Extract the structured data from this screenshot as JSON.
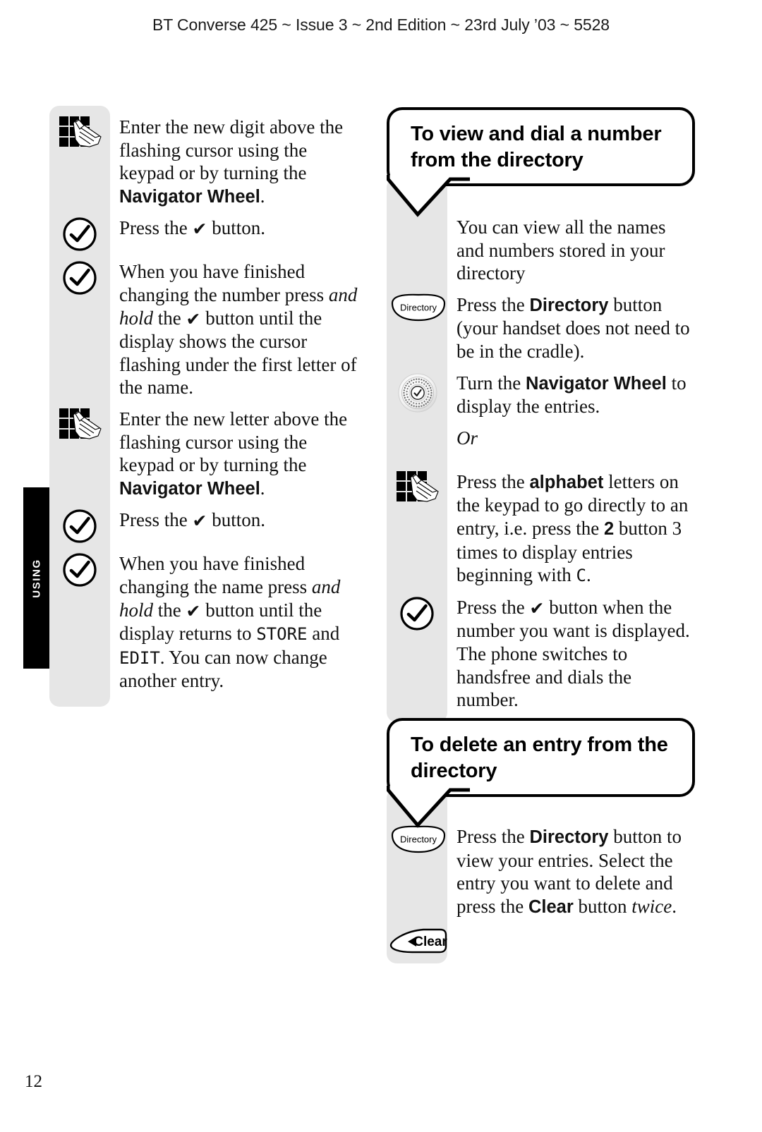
{
  "header": {
    "text": "BT Converse 425 ~ Issue 3 ~ 2nd Edition ~ 23rd July ’03 ~ 5528"
  },
  "side_tab": {
    "label": "USING"
  },
  "page_number": "12",
  "icon_labels": {
    "directory": "Directory",
    "clear": "Clear"
  },
  "left_column": {
    "steps": [
      {
        "icon": "keypad-icon",
        "text_html": "Enter the new digit above the flashing cursor using the keypad or by turning the <span class=\"b\">Navigator Wheel</span>."
      },
      {
        "icon": "check-button-icon",
        "text_html": "Press the <span class=\"tick-inline\">✔</span> button."
      },
      {
        "icon": "check-button-icon",
        "text_html": "When you have finished changing the number press <span class=\"i\">and hold</span> the <span class=\"tick-inline\">✔</span> button until the display shows the cursor flashing under the first letter of the name."
      },
      {
        "icon": "keypad-icon",
        "text_html": "Enter the new letter above the flashing cursor using the keypad or by turning the <span class=\"b\">Navigator Wheel</span>."
      },
      {
        "icon": "check-button-icon",
        "text_html": "Press the <span class=\"tick-inline\">✔</span> button."
      },
      {
        "icon": "check-button-icon",
        "text_html": "When you have finished changing the name press <span class=\"i\">and hold</span> the <span class=\"tick-inline\">✔</span> button until the display returns to <span class=\"lcd\">STORE</span> and <span class=\"lcd\">EDIT</span>. You can now change another entry."
      }
    ]
  },
  "section_view_dial": {
    "title": "To view and dial a number from the directory",
    "steps": [
      {
        "icon": "none",
        "text_html": "You can view all the names and numbers stored in your directory"
      },
      {
        "icon": "directory-button-icon",
        "text_html": "Press the <span class=\"b\">Directory</span> button (your handset does not need to be in the cradle)."
      },
      {
        "icon": "navigator-wheel-icon",
        "text_html": "Turn the <span class=\"b\">Navigator Wheel</span> to display the entries."
      },
      {
        "icon": "none",
        "text_html": "<span class=\"i\">Or</span>"
      },
      {
        "icon": "keypad-icon",
        "text_html": "Press the <span class=\"b\">alphabet</span> letters on the keypad to go directly to an entry, i.e. press the <span class=\"b\">2</span> button 3 times to display entries beginning with <span class=\"lcd\">C</span>."
      },
      {
        "icon": "check-button-icon",
        "text_html": "Press the <span class=\"tick-inline\">✔</span> button when the number you want is displayed. The phone  switches to handsfree and dials the number."
      }
    ]
  },
  "section_delete": {
    "title": "To delete an entry from the directory",
    "steps": [
      {
        "icon": "directory-button-icon",
        "text_html": "Press the <span class=\"b\">Directory</span> button to view your entries. Select the entry you want to delete and press the <span class=\"b\">Clear</span> button <span class=\"i\">twice</span>."
      },
      {
        "icon": "clear-button-icon",
        "text_html": ""
      }
    ]
  },
  "colors": {
    "panel_grey": "#e6e6e6",
    "ink": "#111111",
    "tab_black": "#000000"
  }
}
